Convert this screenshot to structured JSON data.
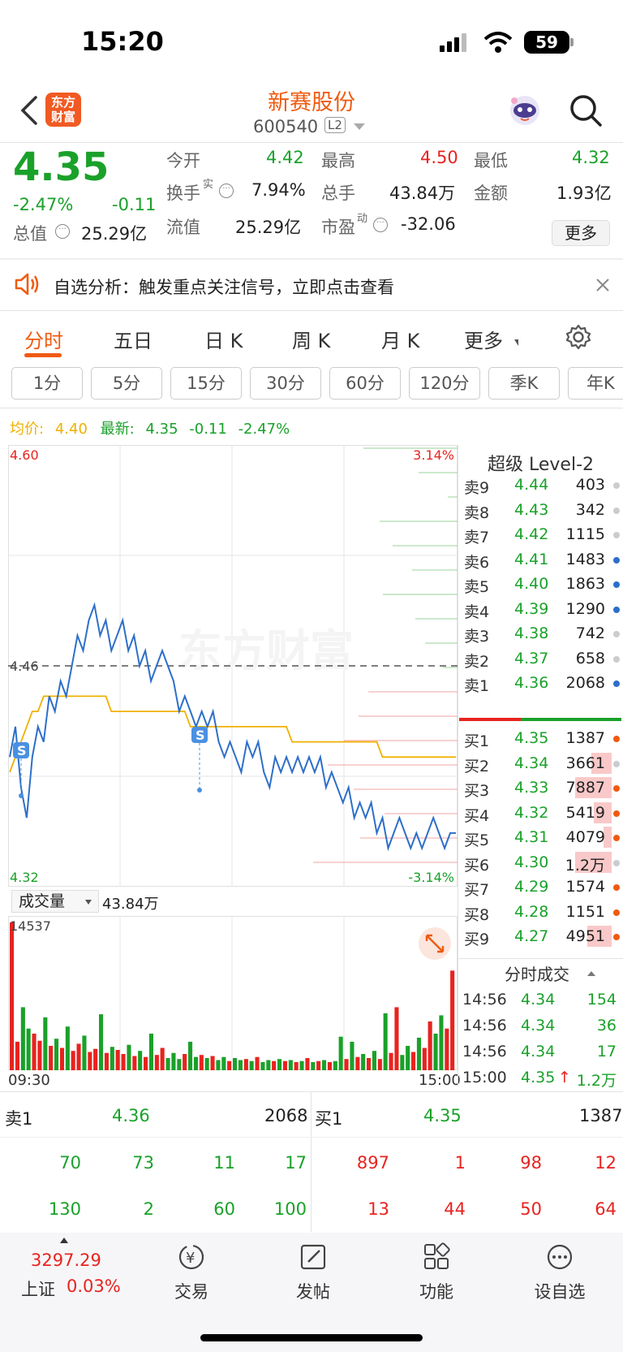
{
  "status_bar": {
    "time": "15:20",
    "battery": "59"
  },
  "header": {
    "logo_line1": "东方",
    "logo_line2": "财富",
    "stock_name": "新赛股份",
    "stock_code": "600540",
    "level_badge": "L2"
  },
  "quote": {
    "price": "4.35",
    "change_pct": "-2.47%",
    "change_abs": "-0.11",
    "open_label": "今开",
    "open": "4.42",
    "high_label": "最高",
    "high": "4.50",
    "low_label": "最低",
    "low": "4.32",
    "turnover_label": "换手",
    "turnover_sup": "实",
    "turnover": "7.94%",
    "volume_label": "总手",
    "volume": "43.84万",
    "amount_label": "金额",
    "amount": "1.93亿",
    "mktcap_label": "总值",
    "mktcap": "25.29亿",
    "float_label": "流值",
    "float_cap": "25.29亿",
    "pe_label": "市盈",
    "pe_sup": "动",
    "pe": "-32.06",
    "more_button": "更多"
  },
  "alert": {
    "text": "自选分析：触发重点关注信号，立即点击查看"
  },
  "tabs": [
    {
      "label": "分时"
    },
    {
      "label": "五日"
    },
    {
      "label": "日 K"
    },
    {
      "label": "周 K"
    },
    {
      "label": "月 K"
    },
    {
      "label": "更多"
    }
  ],
  "period_tabs": [
    {
      "label": "1分"
    },
    {
      "label": "5分"
    },
    {
      "label": "15分"
    },
    {
      "label": "30分"
    },
    {
      "label": "60分"
    },
    {
      "label": "120分"
    },
    {
      "label": "季K"
    },
    {
      "label": "年K"
    }
  ],
  "legend": {
    "avg_label": "均价:",
    "avg_value": "4.40",
    "latest_label": "最新:",
    "latest_value": "4.35",
    "latest_change": "-0.11",
    "latest_pct": "-2.47%"
  },
  "chart_data": {
    "type": "line",
    "y_top_label": "4.60",
    "y_mid_label": "4.46",
    "y_bottom_label": "4.32",
    "pct_top": "3.14%",
    "pct_bottom": "-3.14%",
    "x_start": "09:30",
    "x_end": "15:00",
    "watermark": "东方财富",
    "marker_label": "S",
    "ylim": [
      4.32,
      4.6
    ],
    "prev_close": 4.46,
    "series": [
      {
        "values": [
          4.4,
          4.42,
          4.38,
          4.36,
          4.4,
          4.42,
          4.41,
          4.44,
          4.43,
          4.45,
          4.44,
          4.46,
          4.48,
          4.47,
          4.49,
          4.5,
          4.48,
          4.49,
          4.47,
          4.48,
          4.49,
          4.47,
          4.48,
          4.46,
          4.47,
          4.45,
          4.46,
          4.47,
          4.46,
          4.45,
          4.43,
          4.44,
          4.43,
          4.42,
          4.43,
          4.42,
          4.43,
          4.41,
          4.4,
          4.41,
          4.4,
          4.39,
          4.41,
          4.4,
          4.41,
          4.39,
          4.38,
          4.4,
          4.39,
          4.4,
          4.39,
          4.4,
          4.39,
          4.4,
          4.39,
          4.4,
          4.38,
          4.39,
          4.38,
          4.37,
          4.38,
          4.36,
          4.37,
          4.36,
          4.37,
          4.35,
          4.36,
          4.34,
          4.35,
          4.36,
          4.35,
          4.34,
          4.35,
          4.34,
          4.35,
          4.36,
          4.35,
          4.34,
          4.35,
          4.35
        ]
      },
      {
        "values": [
          4.39,
          4.4,
          4.41,
          4.42,
          4.43,
          4.43,
          4.44,
          4.44,
          4.44,
          4.44,
          4.44,
          4.44,
          4.44,
          4.44,
          4.44,
          4.44,
          4.44,
          4.44,
          4.43,
          4.43,
          4.43,
          4.43,
          4.43,
          4.43,
          4.43,
          4.43,
          4.43,
          4.43,
          4.43,
          4.43,
          4.43,
          4.43,
          4.42,
          4.42,
          4.42,
          4.42,
          4.42,
          4.42,
          4.42,
          4.42,
          4.42,
          4.42,
          4.42,
          4.42,
          4.42,
          4.42,
          4.42,
          4.42,
          4.42,
          4.42,
          4.41,
          4.41,
          4.41,
          4.41,
          4.41,
          4.41,
          4.41,
          4.41,
          4.41,
          4.41,
          4.41,
          4.41,
          4.41,
          4.41,
          4.41,
          4.41,
          4.4,
          4.4,
          4.4,
          4.4,
          4.4,
          4.4,
          4.4,
          4.4,
          4.4,
          4.4,
          4.4,
          4.4,
          4.4,
          4.4
        ]
      }
    ],
    "volume_label": "成交量",
    "volume_total": "43.84万",
    "volume_max": "14537",
    "volume_bars": [
      14537,
      2800,
      6200,
      4100,
      3600,
      2900,
      5200,
      2400,
      3100,
      2200,
      4300,
      1900,
      2600,
      3400,
      1800,
      2100,
      5500,
      1700,
      2300,
      2000,
      1600,
      2500,
      1400,
      1900,
      1300,
      3600,
      1500,
      2200,
      1200,
      1700,
      1100,
      1600,
      2800,
      1300,
      1500,
      1200,
      1400,
      1000,
      1300,
      900,
      1200,
      1000,
      1100,
      900,
      1300,
      800,
      1000,
      900,
      1100,
      900,
      1000,
      800,
      900,
      1200,
      800,
      900,
      1000,
      800,
      900,
      3300,
      1100,
      2800,
      1300,
      1600,
      1200,
      1900,
      1100,
      5600,
      1700,
      6200,
      1500,
      2400,
      1800,
      3200,
      2200,
      4800,
      3600,
      5400,
      4100,
      9800
    ]
  },
  "orderbook": {
    "title": "超级 Level-2",
    "asks": [
      {
        "label": "卖9",
        "price": "4.44",
        "vol": "403"
      },
      {
        "label": "卖8",
        "price": "4.43",
        "vol": "342"
      },
      {
        "label": "卖7",
        "price": "4.42",
        "vol": "1115"
      },
      {
        "label": "卖6",
        "price": "4.41",
        "vol": "1483"
      },
      {
        "label": "卖5",
        "price": "4.40",
        "vol": "1863"
      },
      {
        "label": "卖4",
        "price": "4.39",
        "vol": "1290"
      },
      {
        "label": "卖3",
        "price": "4.38",
        "vol": "742"
      },
      {
        "label": "卖2",
        "price": "4.37",
        "vol": "658"
      },
      {
        "label": "卖1",
        "price": "4.36",
        "vol": "2068"
      }
    ],
    "bids": [
      {
        "label": "买1",
        "price": "4.35",
        "vol": "1387"
      },
      {
        "label": "买2",
        "price": "4.34",
        "vol": "3661"
      },
      {
        "label": "买3",
        "price": "4.33",
        "vol": "7887"
      },
      {
        "label": "买4",
        "price": "4.32",
        "vol": "5419"
      },
      {
        "label": "买5",
        "price": "4.31",
        "vol": "4079"
      },
      {
        "label": "买6",
        "price": "4.30",
        "vol": "1.2万"
      },
      {
        "label": "买7",
        "price": "4.29",
        "vol": "1574"
      },
      {
        "label": "买8",
        "price": "4.28",
        "vol": "1151"
      },
      {
        "label": "买9",
        "price": "4.27",
        "vol": "4951"
      }
    ]
  },
  "ticks": {
    "title": "分时成交",
    "rows": [
      {
        "time": "14:56",
        "price": "4.34",
        "vol": "154"
      },
      {
        "time": "14:56",
        "price": "4.34",
        "vol": "36"
      },
      {
        "time": "14:56",
        "price": "4.34",
        "vol": "17"
      },
      {
        "time": "15:00",
        "price": "4.35",
        "arrow": "↑",
        "vol": "1.2万"
      }
    ]
  },
  "summary": {
    "ask_label": "卖1",
    "ask_price": "4.36",
    "ask_vol": "2068",
    "bid_label": "买1",
    "bid_price": "4.35",
    "bid_vol": "1387",
    "ask_row1": [
      "70",
      "73",
      "11",
      "17"
    ],
    "ask_row2": [
      "130",
      "2",
      "60",
      "100"
    ],
    "bid_row1": [
      "897",
      "1",
      "98",
      "12"
    ],
    "bid_row2": [
      "13",
      "44",
      "50",
      "64"
    ]
  },
  "bottom_nav": {
    "index_value": "3297.29",
    "index_name": "上证",
    "index_pct": "0.03%",
    "trade": "交易",
    "post": "发帖",
    "functions": "功能",
    "watchlist": "设自选"
  }
}
